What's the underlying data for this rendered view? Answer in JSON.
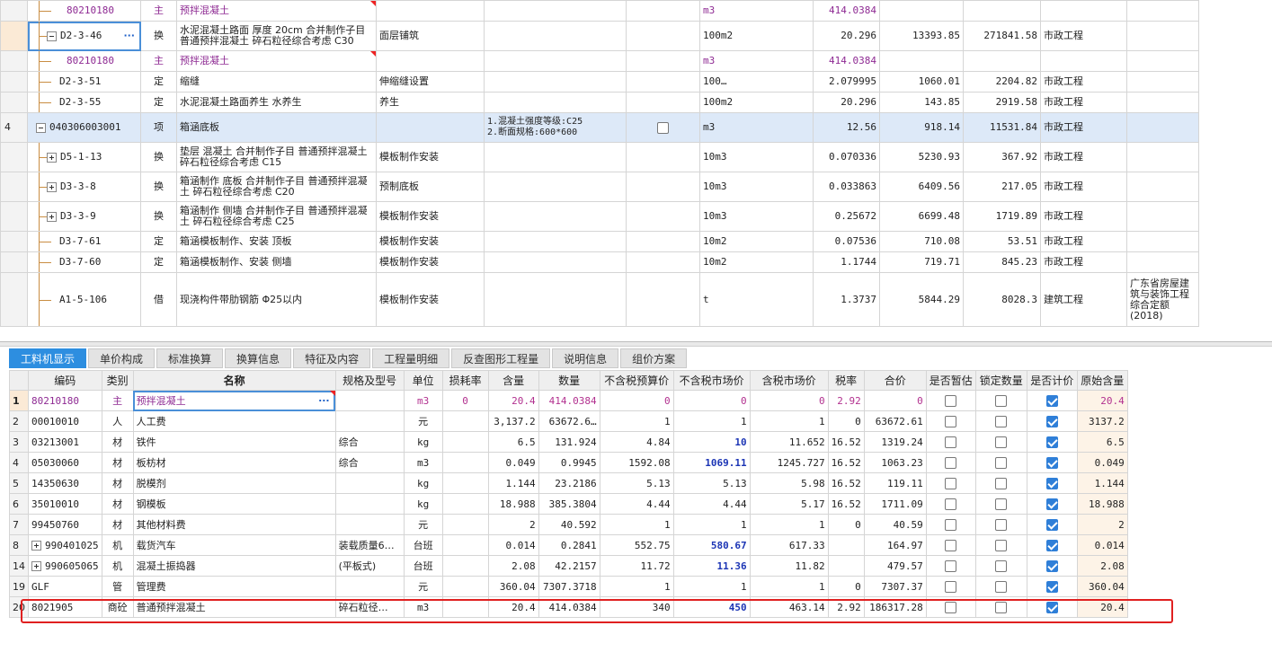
{
  "top_rows": [
    {
      "rn": "",
      "code": "80210180",
      "sub": true,
      "type": "主",
      "name": "预拌混凝土",
      "desc": "",
      "feature": "",
      "check": false,
      "unit": "m3",
      "qty": "414.0384",
      "price": "",
      "total": "",
      "major": "",
      "note": "",
      "purple": true,
      "redcorner": true
    },
    {
      "rn": "",
      "code": "D2-3-46",
      "expand": "minus",
      "type": "换",
      "name": "水泥混凝土路面 厚度 20cm  合并制作子目 普通预拌混凝土 碎石粒径综合考虑 C30",
      "desc": "面层铺筑",
      "feature": "",
      "check": false,
      "unit": "100m2",
      "qty": "20.296",
      "price": "13393.85",
      "total": "271841.58",
      "major": "市政工程",
      "note": "",
      "focus": true,
      "tall": true
    },
    {
      "rn": "",
      "code": "80210180",
      "sub": true,
      "type": "主",
      "name": "预拌混凝土",
      "desc": "",
      "feature": "",
      "check": false,
      "unit": "m3",
      "qty": "414.0384",
      "price": "",
      "total": "",
      "major": "",
      "note": "",
      "purple": true,
      "redcorner": true
    },
    {
      "rn": "",
      "code": "D2-3-51",
      "type": "定",
      "name": "缩缝",
      "desc": "伸缩缝设置",
      "feature": "",
      "check": false,
      "unit": "100…",
      "qty": "2.079995",
      "price": "1060.01",
      "total": "2204.82",
      "major": "市政工程",
      "note": ""
    },
    {
      "rn": "",
      "code": "D2-3-55",
      "type": "定",
      "name": "水泥混凝土路面养生 水养生",
      "desc": "养生",
      "feature": "",
      "check": false,
      "unit": "100m2",
      "qty": "20.296",
      "price": "143.85",
      "total": "2919.58",
      "major": "市政工程",
      "note": ""
    },
    {
      "rn": "4",
      "code": "040306003001",
      "expand": "minus",
      "top": true,
      "type": "项",
      "name": "箱涵底板",
      "desc": "",
      "feature": "1.混凝土强度等级:C25\n2.断面规格:600*600",
      "check": true,
      "unit": "m3",
      "qty": "12.56",
      "price": "918.14",
      "total": "11531.84",
      "major": "市政工程",
      "note": "",
      "selected": true,
      "tall": true
    },
    {
      "rn": "",
      "code": "D5-1-13",
      "expand": "plus",
      "type": "换",
      "name": "垫层 混凝土  合并制作子目 普通预拌混凝土 碎石粒径综合考虑 C15",
      "desc": "模板制作安装",
      "feature": "",
      "check": false,
      "unit": "10m3",
      "qty": "0.070336",
      "price": "5230.93",
      "total": "367.92",
      "major": "市政工程",
      "note": "",
      "tall": true
    },
    {
      "rn": "",
      "code": "D3-3-8",
      "expand": "plus",
      "type": "换",
      "name": "箱涵制作 底板  合并制作子目 普通预拌混凝土 碎石粒径综合考虑 C20",
      "desc": "预制底板",
      "feature": "",
      "check": false,
      "unit": "10m3",
      "qty": "0.033863",
      "price": "6409.56",
      "total": "217.05",
      "major": "市政工程",
      "note": "",
      "tall": true
    },
    {
      "rn": "",
      "code": "D3-3-9",
      "expand": "plus",
      "type": "换",
      "name": "箱涵制作 侧墙  合并制作子目 普通预拌混凝土 碎石粒径综合考虑 C25",
      "desc": "模板制作安装",
      "feature": "",
      "check": false,
      "unit": "10m3",
      "qty": "0.25672",
      "price": "6699.48",
      "total": "1719.89",
      "major": "市政工程",
      "note": "",
      "tall": true
    },
    {
      "rn": "",
      "code": "D3-7-61",
      "type": "定",
      "name": "箱涵模板制作、安装 顶板",
      "desc": "模板制作安装",
      "feature": "",
      "check": false,
      "unit": "10m2",
      "qty": "0.07536",
      "price": "710.08",
      "total": "53.51",
      "major": "市政工程",
      "note": ""
    },
    {
      "rn": "",
      "code": "D3-7-60",
      "type": "定",
      "name": "箱涵模板制作、安装 侧墙",
      "desc": "模板制作安装",
      "feature": "",
      "check": false,
      "unit": "10m2",
      "qty": "1.1744",
      "price": "719.71",
      "total": "845.23",
      "major": "市政工程",
      "note": ""
    },
    {
      "rn": "",
      "code": "A1-5-106",
      "type": "借",
      "name": "现浇构件带肋钢筋 Φ25以内",
      "desc": "模板制作安装",
      "feature": "",
      "check": false,
      "unit": "t",
      "qty": "1.3737",
      "price": "5844.29",
      "total": "8028.3",
      "major": "建筑工程",
      "note": "广东省房屋建筑与装饰工程综合定额(2018)",
      "huge": true
    }
  ],
  "tabs": [
    "工料机显示",
    "单价构成",
    "标准换算",
    "换算信息",
    "特征及内容",
    "工程量明细",
    "反查图形工程量",
    "说明信息",
    "组价方案"
  ],
  "bottom_headers": [
    "",
    "编码",
    "类别",
    "名称",
    "规格及型号",
    "单位",
    "损耗率",
    "含量",
    "数量",
    "不含税预算价",
    "不含税市场价",
    "含税市场价",
    "税率",
    "合价",
    "是否暂估",
    "锁定数量",
    "是否计价",
    "原始含量"
  ],
  "bottom_rows": [
    {
      "rn": "1",
      "code": "80210180",
      "expand": "",
      "type": "主",
      "name": "预拌混凝土",
      "spec": "",
      "unit": "m3",
      "loss": "0",
      "content": "20.4",
      "qty": "414.0384",
      "pre": "0",
      "mkt": "0",
      "mkt_tax": "0",
      "rate": "2.92",
      "total": "0",
      "est": false,
      "lock": false,
      "price": true,
      "orig": "20.4",
      "purple": true
    },
    {
      "rn": "2",
      "code": "00010010",
      "type": "人",
      "name": "人工费",
      "spec": "",
      "unit": "元",
      "loss": "",
      "content": "3,137.2",
      "qty": "63672.6…",
      "pre": "1",
      "mkt": "1",
      "mkt_tax": "1",
      "rate": "0",
      "total": "63672.61",
      "est": false,
      "lock": false,
      "price": true,
      "orig": "3137.2"
    },
    {
      "rn": "3",
      "code": "03213001",
      "type": "材",
      "name": "铁件",
      "spec": "综合",
      "unit": "kg",
      "loss": "",
      "content": "6.5",
      "qty": "131.924",
      "pre": "4.84",
      "mkt": "10",
      "mkt_tax": "11.652",
      "rate": "16.52",
      "total": "1319.24",
      "est": false,
      "lock": false,
      "price": true,
      "orig": "6.5",
      "blue": true
    },
    {
      "rn": "4",
      "code": "05030060",
      "type": "材",
      "name": "板枋材",
      "spec": "综合",
      "unit": "m3",
      "loss": "",
      "content": "0.049",
      "qty": "0.9945",
      "pre": "1592.08",
      "mkt": "1069.11",
      "mkt_tax": "1245.727",
      "rate": "16.52",
      "total": "1063.23",
      "est": false,
      "lock": false,
      "price": true,
      "orig": "0.049",
      "blue": true
    },
    {
      "rn": "5",
      "code": "14350630",
      "type": "材",
      "name": "脱模剂",
      "spec": "",
      "unit": "kg",
      "loss": "",
      "content": "1.144",
      "qty": "23.2186",
      "pre": "5.13",
      "mkt": "5.13",
      "mkt_tax": "5.98",
      "rate": "16.52",
      "total": "119.11",
      "est": false,
      "lock": false,
      "price": true,
      "orig": "1.144"
    },
    {
      "rn": "6",
      "code": "35010010",
      "type": "材",
      "name": "钢模板",
      "spec": "",
      "unit": "kg",
      "loss": "",
      "content": "18.988",
      "qty": "385.3804",
      "pre": "4.44",
      "mkt": "4.44",
      "mkt_tax": "5.17",
      "rate": "16.52",
      "total": "1711.09",
      "est": false,
      "lock": false,
      "price": true,
      "orig": "18.988"
    },
    {
      "rn": "7",
      "code": "99450760",
      "type": "材",
      "name": "其他材料费",
      "spec": "",
      "unit": "元",
      "loss": "",
      "content": "2",
      "qty": "40.592",
      "pre": "1",
      "mkt": "1",
      "mkt_tax": "1",
      "rate": "0",
      "total": "40.59",
      "est": false,
      "lock": false,
      "price": true,
      "orig": "2"
    },
    {
      "rn": "8",
      "code": "990401025",
      "expand": "plus",
      "type": "机",
      "name": "载货汽车",
      "spec": "装载质量6…",
      "unit": "台班",
      "loss": "",
      "content": "0.014",
      "qty": "0.2841",
      "pre": "552.75",
      "mkt": "580.67",
      "mkt_tax": "617.33",
      "rate": "",
      "total": "164.97",
      "est": false,
      "lock": false,
      "price": true,
      "orig": "0.014",
      "blue": true
    },
    {
      "rn": "14",
      "code": "990605065",
      "expand": "plus",
      "type": "机",
      "name": "混凝土振捣器",
      "spec": "(平板式)",
      "unit": "台班",
      "loss": "",
      "content": "2.08",
      "qty": "42.2157",
      "pre": "11.72",
      "mkt": "11.36",
      "mkt_tax": "11.82",
      "rate": "",
      "total": "479.57",
      "est": false,
      "lock": false,
      "price": true,
      "orig": "2.08",
      "blue": true
    },
    {
      "rn": "19",
      "code": "GLF",
      "type": "管",
      "name": "管理费",
      "spec": "",
      "unit": "元",
      "loss": "",
      "content": "360.04",
      "qty": "7307.3718",
      "pre": "1",
      "mkt": "1",
      "mkt_tax": "1",
      "rate": "0",
      "total": "7307.37",
      "est": false,
      "lock": false,
      "price": true,
      "orig": "360.04"
    },
    {
      "rn": "20",
      "code": "8021905",
      "type": "商砼",
      "name": "普通预拌混凝土",
      "spec": "碎石粒径…",
      "unit": "m3",
      "loss": "",
      "content": "20.4",
      "qty": "414.0384",
      "pre": "340",
      "mkt": "450",
      "mkt_tax": "463.14",
      "rate": "2.92",
      "total": "186317.28",
      "est": false,
      "lock": false,
      "price": true,
      "orig": "20.4",
      "blue": true
    }
  ],
  "colors": {
    "tab_active": "#2d8ee0",
    "selected_row": "#dde9f8",
    "highlight_box": "#e02020",
    "purple_text": "#8e2a93",
    "blue_value": "#1c35b5"
  }
}
